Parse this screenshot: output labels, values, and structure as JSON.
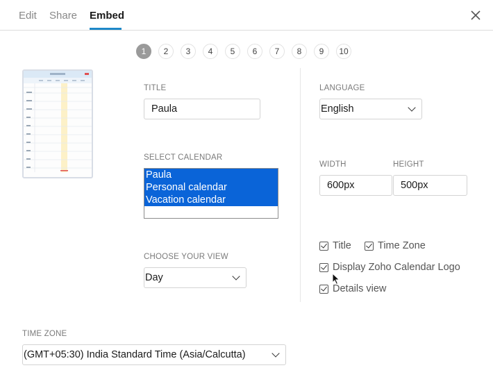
{
  "tabs": [
    {
      "label": "Edit",
      "active": false
    },
    {
      "label": "Share",
      "active": false
    },
    {
      "label": "Embed",
      "active": true
    }
  ],
  "accent_color": "#1e88c8",
  "selection_color": "#0a64d8",
  "steps": [
    "1",
    "2",
    "3",
    "4",
    "5",
    "6",
    "7",
    "8",
    "9",
    "10"
  ],
  "active_step": "1",
  "form": {
    "title_label": "TITLE",
    "title_value": "Paula",
    "select_calendar_label": "SELECT CALENDAR",
    "calendars": [
      "Paula",
      "Personal calendar",
      "Vacation calendar"
    ],
    "view_label": "CHOOSE YOUR VIEW",
    "view_value": "Day",
    "language_label": "LANGUAGE",
    "language_value": "English",
    "width_label": "WIDTH",
    "width_value": "600px",
    "height_label": "HEIGHT",
    "height_value": "500px",
    "options": {
      "title": {
        "label": "Title",
        "checked": true
      },
      "time_zone": {
        "label": "Time Zone",
        "checked": true
      },
      "logo": {
        "label": "Display Zoho Calendar Logo",
        "checked": true
      },
      "details": {
        "label": "Details view",
        "checked": true
      }
    },
    "timezone_label": "TIME ZONE",
    "timezone_value": "(GMT+05:30) India Standard Time (Asia/Calcutta)"
  },
  "icons": {
    "close": "close-icon",
    "dropdown": "chevron-down-icon",
    "check": "checkmark-icon",
    "cursor": "mouse-pointer-icon"
  }
}
